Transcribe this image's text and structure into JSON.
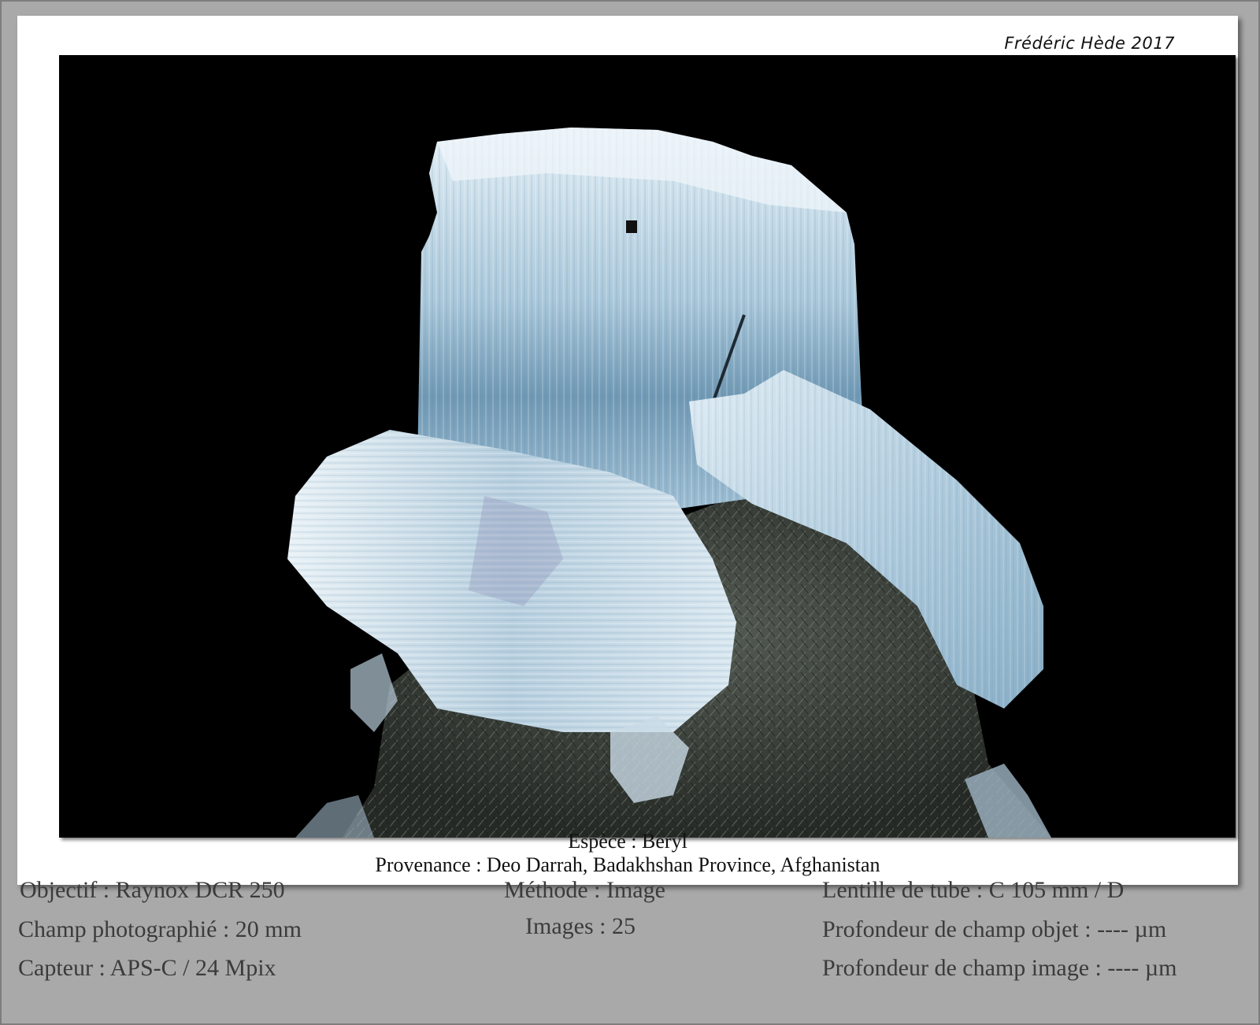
{
  "signature": "Frédéric Hède 2017",
  "caption": {
    "species": "Espèce : Beryl",
    "origin": "Provenance : Deo Darrah, Badakhshan Province, Afghanistan"
  },
  "specs": {
    "left": [
      "Objectif : Raynox DCR 250",
      "Champ photographié : 20 mm",
      "Capteur : APS-C / 24 Mpix"
    ],
    "center": [
      "Méthode : Image",
      "Images : 25"
    ],
    "right": [
      "Lentille de tube : C 105 mm / D",
      "Profondeur de champ objet : ---- µm",
      "Profondeur de champ image : ---- µm"
    ]
  },
  "colors": {
    "background": "#a9a9a9",
    "card": "#ffffff",
    "photo_background": "#000000",
    "crystal": "#b9d3e2",
    "matrix": "#3a3f3a"
  }
}
